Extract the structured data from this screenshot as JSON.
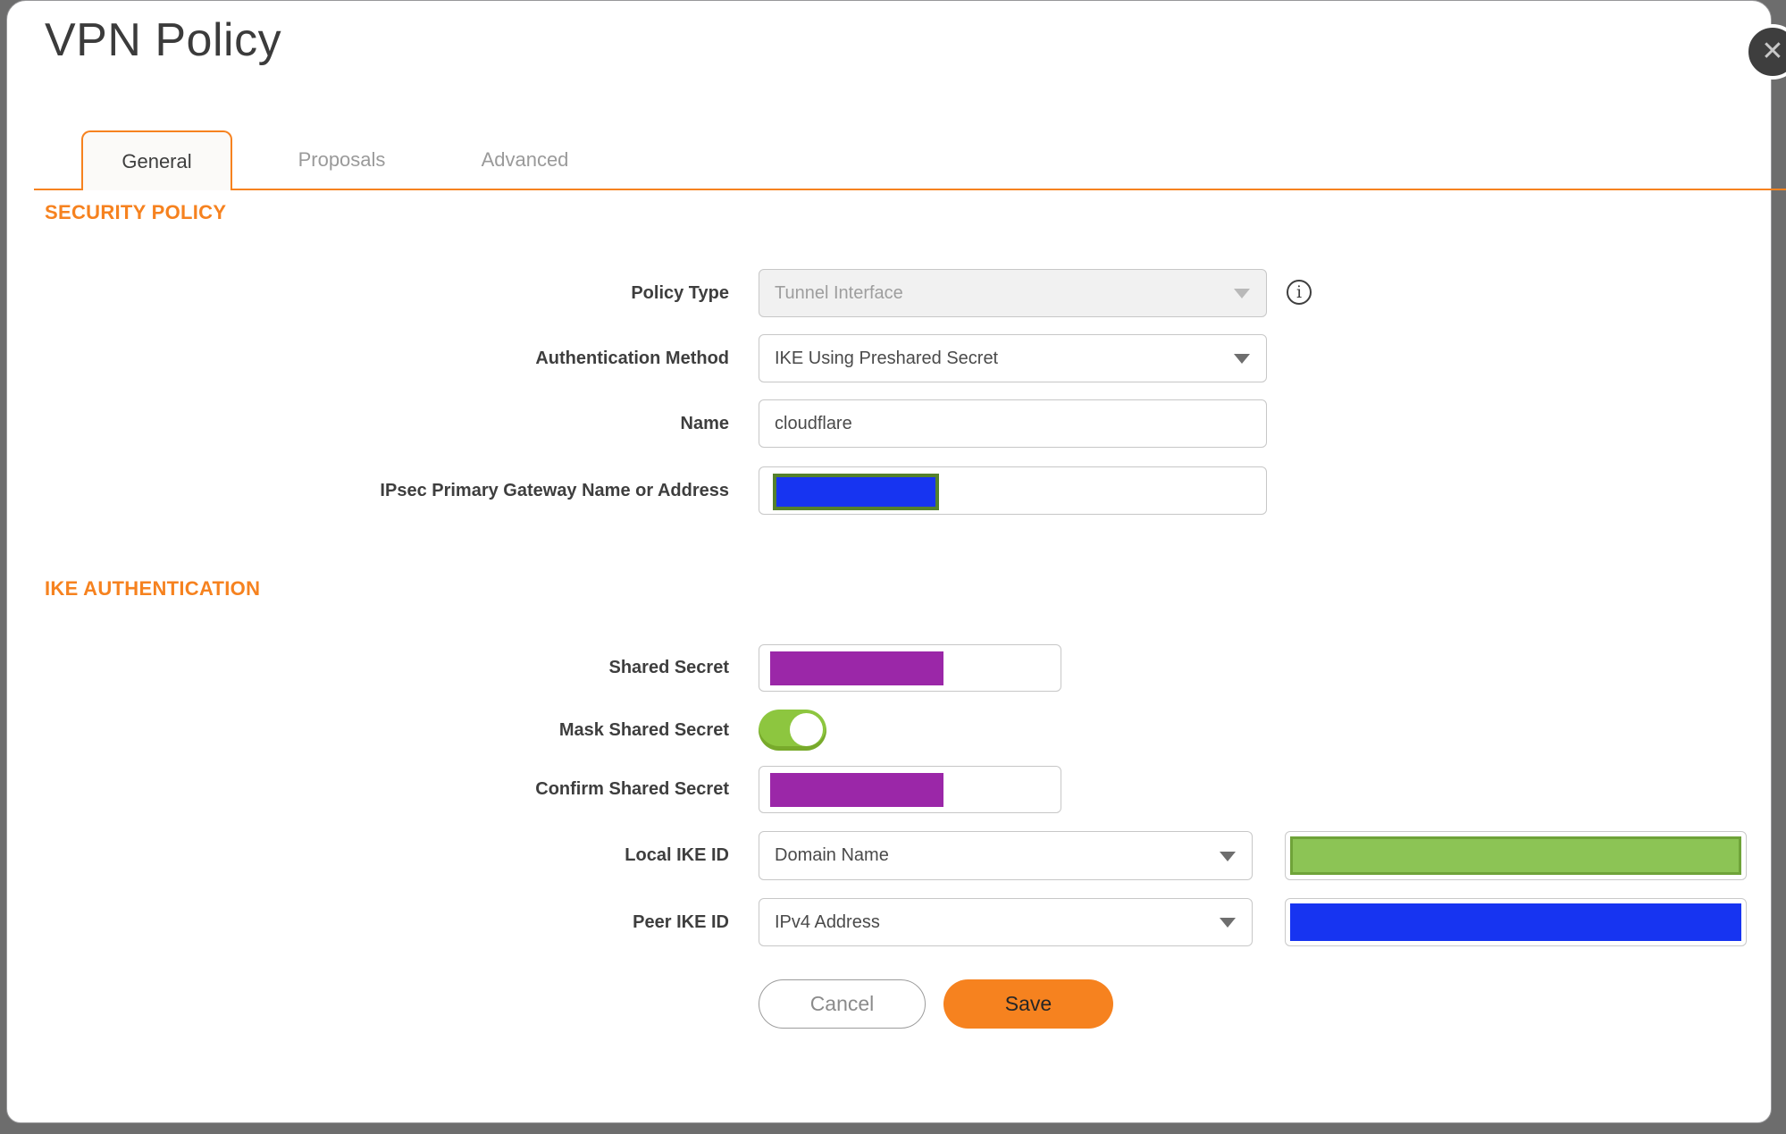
{
  "dialog": {
    "title": "VPN Policy",
    "close_icon": "✕"
  },
  "tabs": {
    "general": "General",
    "proposals": "Proposals",
    "advanced": "Advanced",
    "active_tab": "General"
  },
  "sections": {
    "security_policy": "SECURITY POLICY",
    "ike_authentication": "IKE AUTHENTICATION"
  },
  "fields": {
    "policy_type": {
      "label": "Policy Type",
      "value": "Tunnel Interface",
      "disabled": "true"
    },
    "authentication_method": {
      "label": "Authentication Method",
      "value": "IKE Using Preshared Secret"
    },
    "name": {
      "label": "Name",
      "value": "cloudflare"
    },
    "ipsec_gateway": {
      "label": "IPsec Primary Gateway Name or Address",
      "value_redacted": "blue"
    },
    "shared_secret": {
      "label": "Shared Secret",
      "value_redacted": "purple"
    },
    "mask_shared_secret": {
      "label": "Mask Shared Secret",
      "state": "on"
    },
    "confirm_shared_secret": {
      "label": "Confirm Shared Secret",
      "value_redacted": "purple"
    },
    "local_ike_id": {
      "label": "Local IKE ID",
      "type_value": "Domain Name",
      "value_redacted": "green"
    },
    "peer_ike_id": {
      "label": "Peer IKE ID",
      "type_value": "IPv4 Address",
      "value_redacted": "blue"
    }
  },
  "buttons": {
    "cancel": "Cancel",
    "save": "Save"
  },
  "icons": {
    "info": "i"
  },
  "colors": {
    "accent_orange": "#F6821F",
    "redaction_blue": "#1734F1",
    "redaction_purple": "#9B27A8",
    "redaction_green": "#8CC455",
    "redaction_green_border": "#6FA339",
    "redaction_olive_border": "#55812C",
    "toggle_green": "#8DC63F"
  }
}
